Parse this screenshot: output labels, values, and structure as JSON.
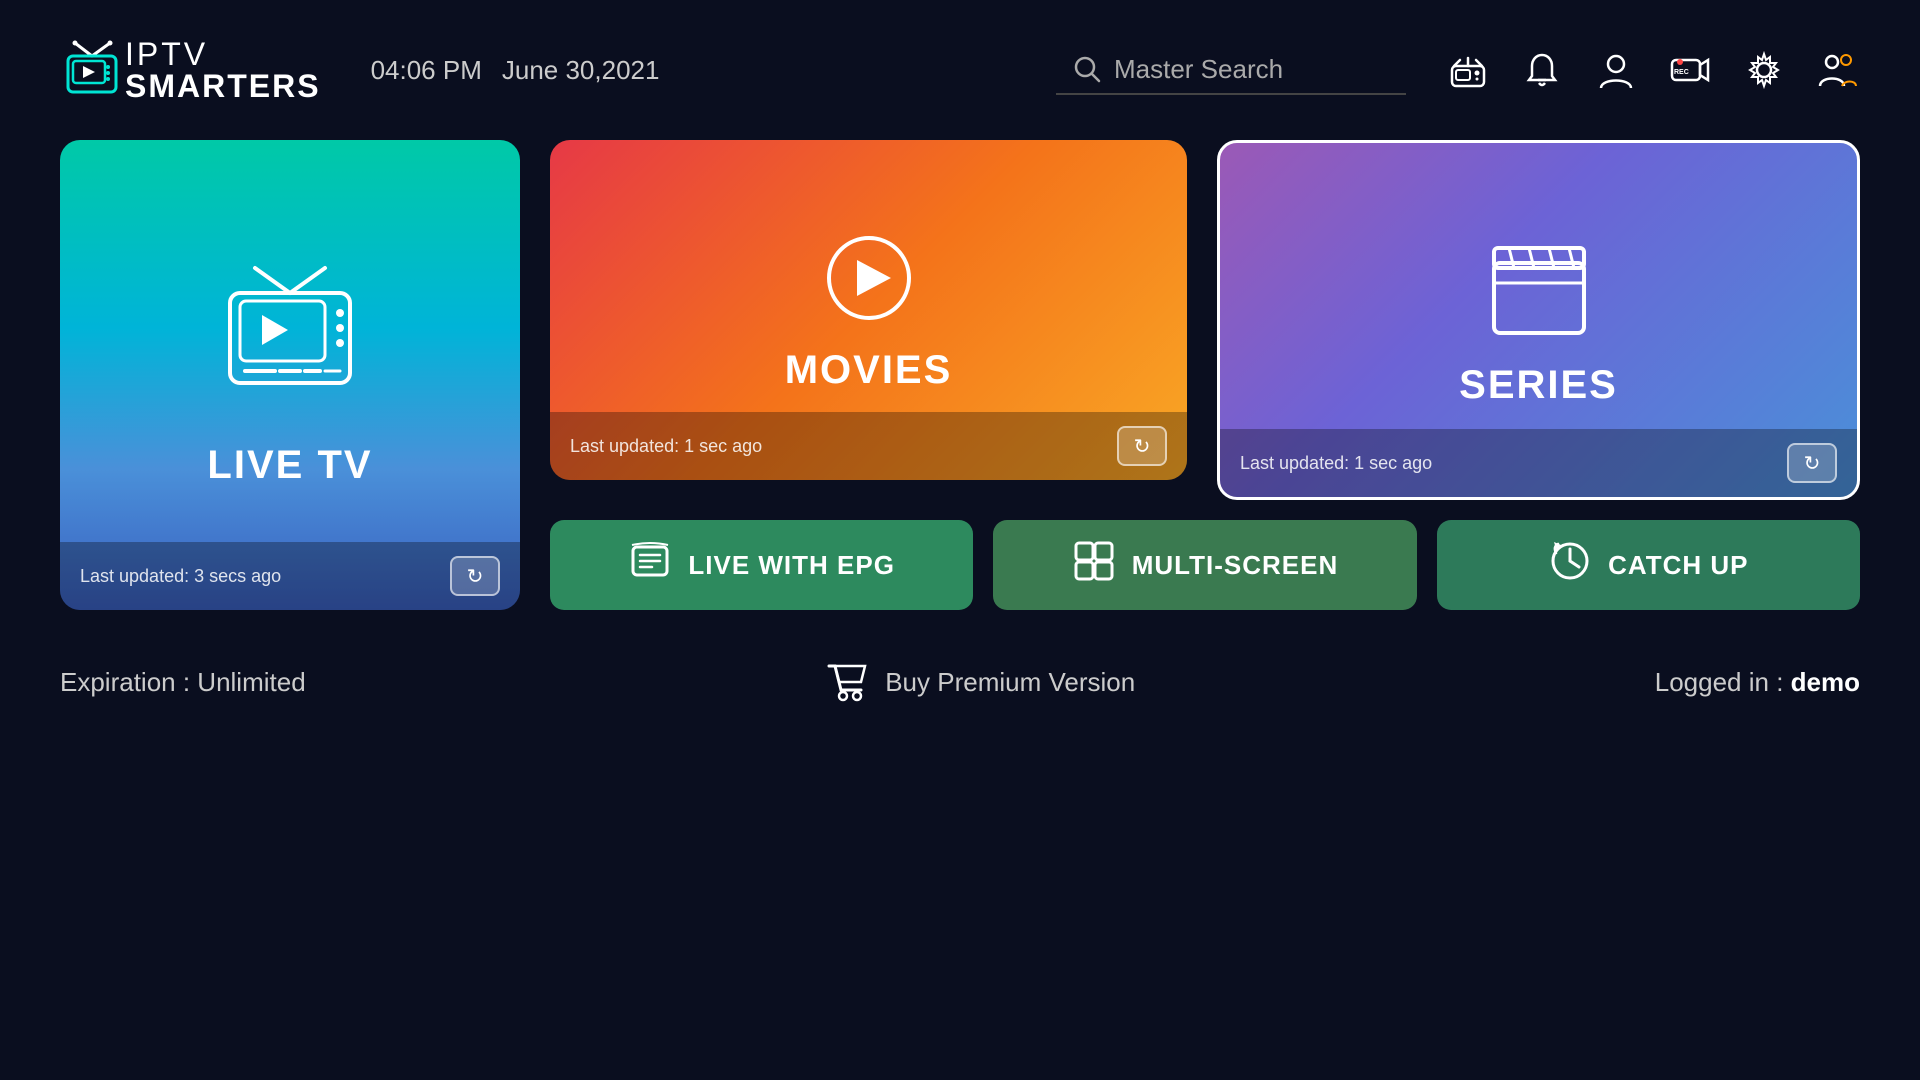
{
  "header": {
    "logo_text_iptv": "IPTV",
    "logo_text_smarters": "SMARTERS",
    "time": "04:06 PM",
    "date": "June 30,2021",
    "search_placeholder": "Master Search",
    "nav_icons": {
      "radio": "📻",
      "notification": "🔔",
      "profile": "👤",
      "record": "📹",
      "settings": "⚙️",
      "users": "👥"
    }
  },
  "cards": {
    "live_tv": {
      "title": "LIVE TV",
      "last_updated": "Last updated: 3 secs ago",
      "refresh_label": "↻"
    },
    "movies": {
      "title": "MOVIES",
      "last_updated": "Last updated: 1 sec ago",
      "refresh_label": "↻"
    },
    "series": {
      "title": "SERIES",
      "last_updated": "Last updated: 1 sec ago",
      "refresh_label": "↻"
    }
  },
  "feature_buttons": {
    "live_epg": {
      "label": "LIVE WITH EPG",
      "icon": "📖"
    },
    "multi_screen": {
      "label": "MULTI-SCREEN",
      "icon": "⊞"
    },
    "catch_up": {
      "label": "CATCH UP",
      "icon": "🕐"
    }
  },
  "footer": {
    "expiration_label": "Expiration : ",
    "expiration_value": "Unlimited",
    "buy_premium": "Buy Premium Version",
    "cart_icon": "🛒",
    "logged_in_label": "Logged in : ",
    "logged_in_user": "demo"
  }
}
